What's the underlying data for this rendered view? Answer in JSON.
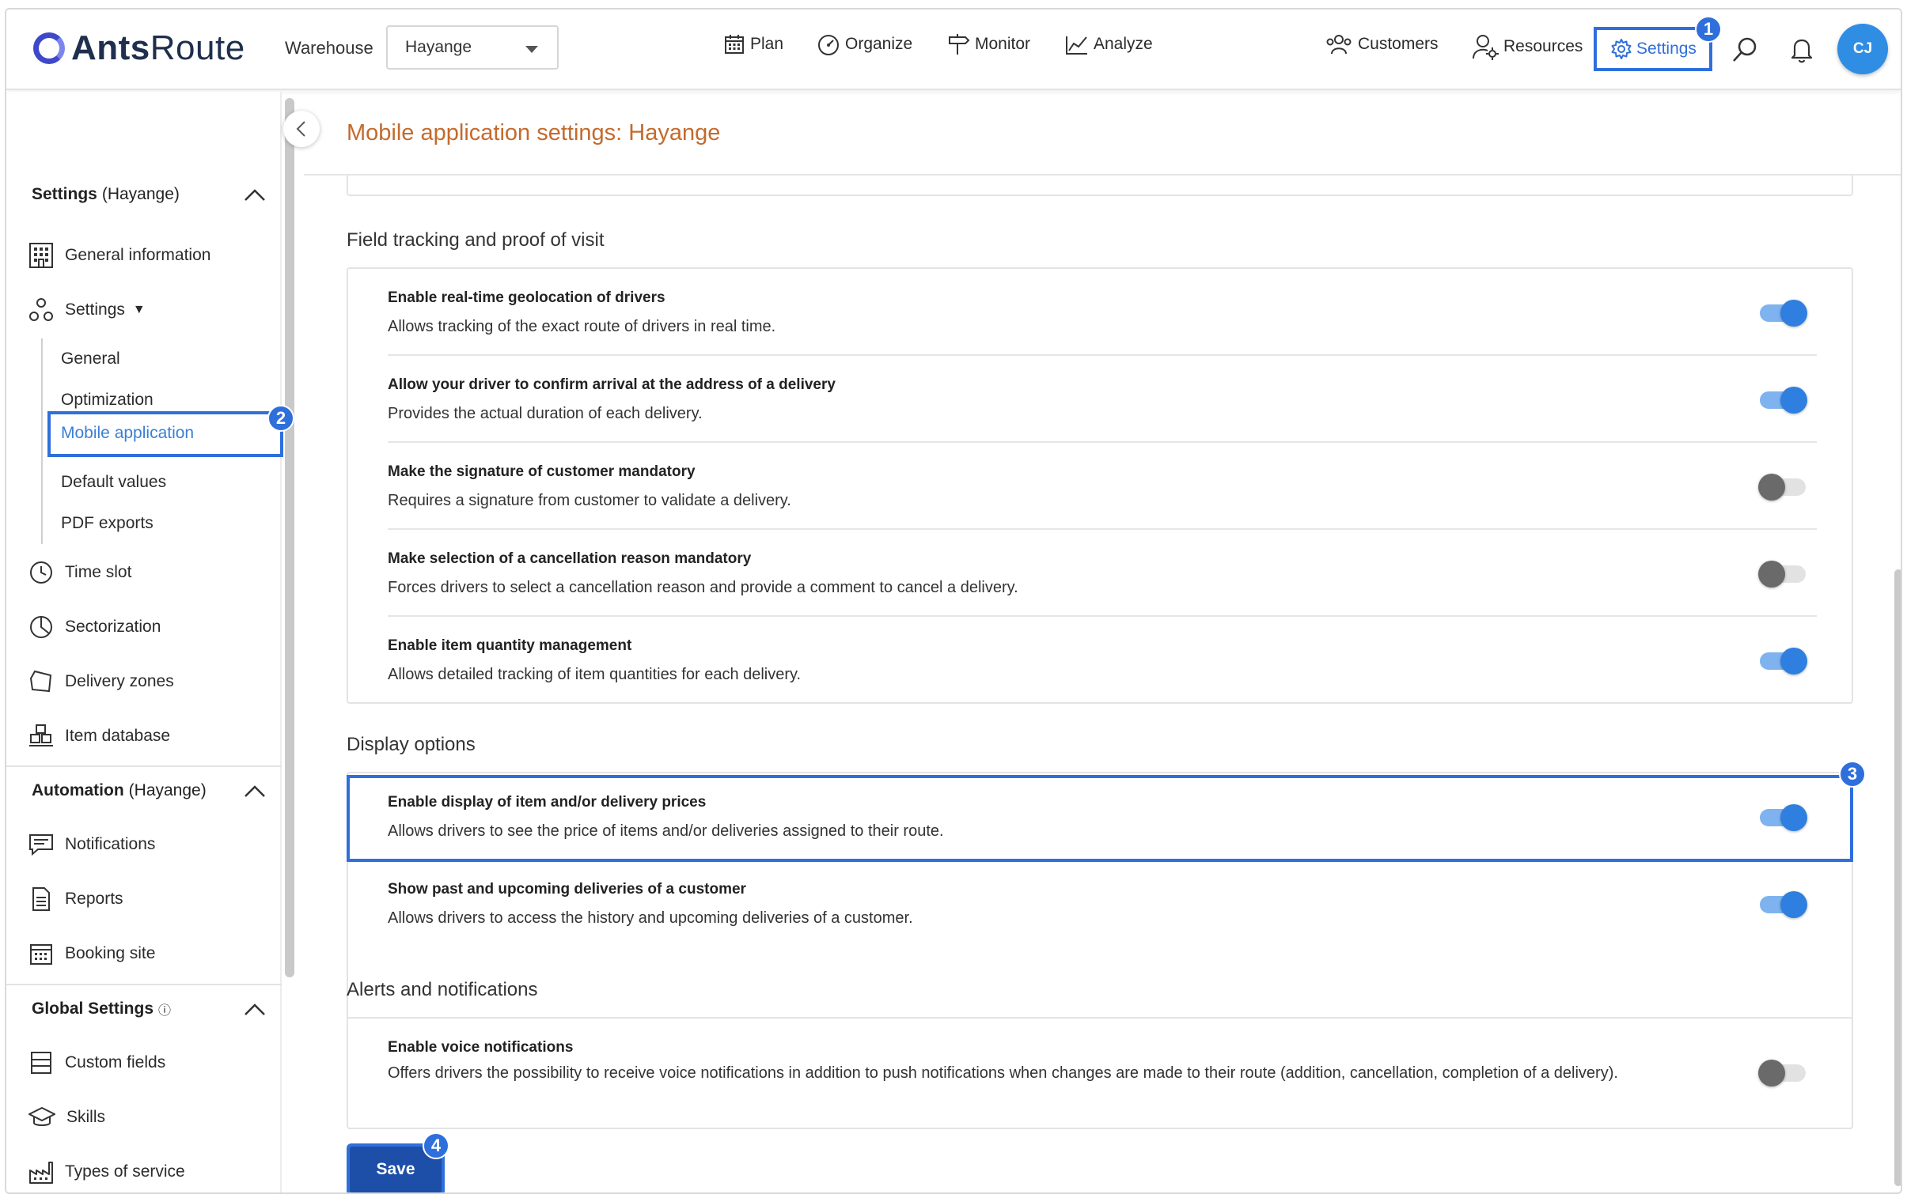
{
  "app": {
    "brand_bold": "Ants",
    "brand_rest": "Route"
  },
  "header": {
    "warehouse_label": "Warehouse",
    "warehouse_value": "Hayange",
    "nav": {
      "plan": "Plan",
      "organize": "Organize",
      "monitor": "Monitor",
      "analyze": "Analyze"
    },
    "customers": "Customers",
    "resources": "Resources",
    "settings": "Settings",
    "avatar_initials": "CJ"
  },
  "badges": {
    "b1": "1",
    "b2": "2",
    "b3": "3",
    "b4": "4"
  },
  "sidebar": {
    "settings_section": {
      "title": "Settings",
      "context": "(Hayange)"
    },
    "general_information": "General information",
    "settings_group": "Settings",
    "settings_caret": "▼",
    "sub": [
      "General",
      "Optimization",
      "Mobile application",
      "Default values",
      "PDF exports"
    ],
    "time_slot": "Time slot",
    "sectorization": "Sectorization",
    "delivery_zones": "Delivery zones",
    "item_database": "Item database",
    "automation_section": {
      "title": "Automation",
      "context": "(Hayange)"
    },
    "notifications": "Notifications",
    "reports": "Reports",
    "booking_site": "Booking site",
    "global_section": {
      "title": "Global Settings",
      "info": "ⓘ"
    },
    "custom_fields": "Custom fields",
    "skills": "Skills",
    "types_of_service": "Types of service"
  },
  "main": {
    "title": "Mobile application settings: Hayange",
    "sections": {
      "field_tracking": {
        "title": "Field tracking and proof of visit",
        "rows": [
          {
            "title": "Enable real-time geolocation of drivers",
            "desc": "Allows tracking of the exact route of drivers in real time.",
            "enabled": true
          },
          {
            "title": "Allow your driver to confirm arrival at the address of a delivery",
            "desc": "Provides the actual duration of each delivery.",
            "enabled": true
          },
          {
            "title": "Make the signature of customer mandatory",
            "desc": "Requires a signature from customer to validate a delivery.",
            "enabled": false
          },
          {
            "title": "Make selection of a cancellation reason mandatory",
            "desc": "Forces drivers to select a cancellation reason and provide a comment to cancel a delivery.",
            "enabled": false
          },
          {
            "title": "Enable item quantity management",
            "desc": "Allows detailed tracking of item quantities for each delivery.",
            "enabled": true
          }
        ]
      },
      "display_options": {
        "title": "Display options",
        "rows": [
          {
            "title": "Enable display of item and/or delivery prices",
            "desc": "Allows drivers to see the price of items and/or deliveries assigned to their route.",
            "enabled": true
          },
          {
            "title": "Show past and upcoming deliveries of a customer",
            "desc": "Allows drivers to access the history and upcoming deliveries of a customer.",
            "enabled": true
          }
        ]
      },
      "alerts": {
        "title": "Alerts and notifications",
        "rows": [
          {
            "title": "Enable voice notifications",
            "desc": "Offers drivers the possibility to receive voice notifications in addition to push notifications when changes are made to their route (addition, cancellation, completion of a delivery).",
            "enabled": false
          }
        ]
      }
    },
    "save_label": "Save"
  },
  "colors": {
    "accent": "#2f6fdc",
    "title": "#c46a2d",
    "toggle_on": "#2f7fe1",
    "toggle_off": "#6a6a6a",
    "save": "#1d4fa8"
  }
}
